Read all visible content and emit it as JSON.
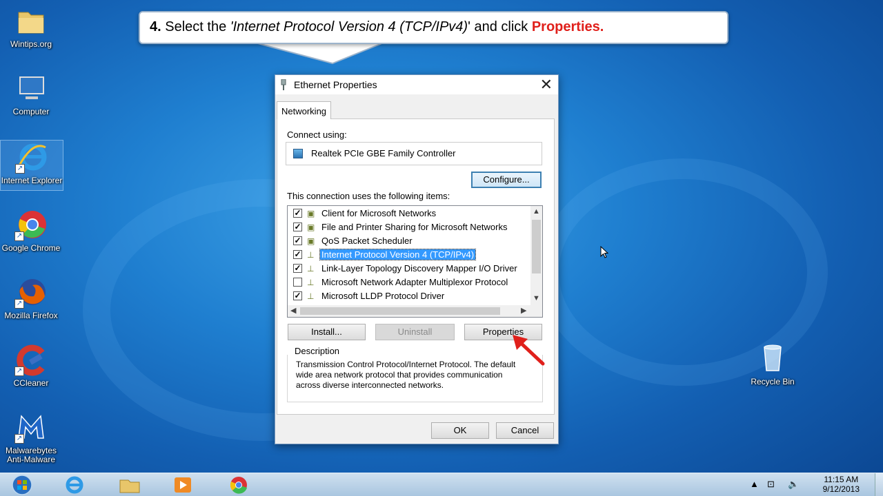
{
  "callout": {
    "step": "4.",
    "text_a": "Select the",
    "text_italic": "'Internet Protocol Version 4 (TCP/IPv4)",
    "text_b": "' and click",
    "text_red": "Properties."
  },
  "desktop": {
    "icons": [
      {
        "label": "Wintips.org",
        "icon": "folder-icon"
      },
      {
        "label": "Computer",
        "icon": "computer-icon"
      },
      {
        "label": "Internet Explorer",
        "icon": "ie-icon"
      },
      {
        "label": "Google Chrome",
        "icon": "chrome-icon"
      },
      {
        "label": "Mozilla Firefox",
        "icon": "firefox-icon"
      },
      {
        "label": "CCleaner",
        "icon": "ccleaner-icon"
      },
      {
        "label": "Malwarebytes Anti-Malware",
        "icon": "malwarebytes-icon"
      },
      {
        "label": "Recycle Bin",
        "icon": "recycle-bin-icon"
      }
    ]
  },
  "dialog": {
    "title": "Ethernet Properties",
    "tab": "Networking",
    "connect_using_label": "Connect using:",
    "adapter": "Realtek PCIe GBE Family Controller",
    "configure_label": "Configure...",
    "items_label": "This connection uses the following items:",
    "items": [
      {
        "label": "Client for Microsoft Networks",
        "checked": true,
        "selected": false
      },
      {
        "label": "File and Printer Sharing for Microsoft Networks",
        "checked": true,
        "selected": false
      },
      {
        "label": "QoS Packet Scheduler",
        "checked": true,
        "selected": false
      },
      {
        "label": "Internet Protocol Version 4 (TCP/IPv4)",
        "checked": true,
        "selected": true
      },
      {
        "label": "Link-Layer Topology Discovery Mapper I/O Driver",
        "checked": true,
        "selected": false
      },
      {
        "label": "Microsoft Network Adapter Multiplexor Protocol",
        "checked": false,
        "selected": false
      },
      {
        "label": "Microsoft LLDP Protocol Driver",
        "checked": true,
        "selected": false
      }
    ],
    "install_label": "Install...",
    "uninstall_label": "Uninstall",
    "properties_label": "Properties",
    "description_title": "Description",
    "description_lines": [
      "Transmission Control Protocol/Internet Protocol. The default",
      "wide area network protocol that provides communication",
      "across diverse interconnected networks."
    ],
    "ok_label": "OK",
    "cancel_label": "Cancel"
  },
  "taskbar": {
    "time": "11:15 AM",
    "date": "9/12/2013"
  },
  "colors": {
    "accent_red": "#e0201b",
    "selection_blue": "#3399ff"
  }
}
